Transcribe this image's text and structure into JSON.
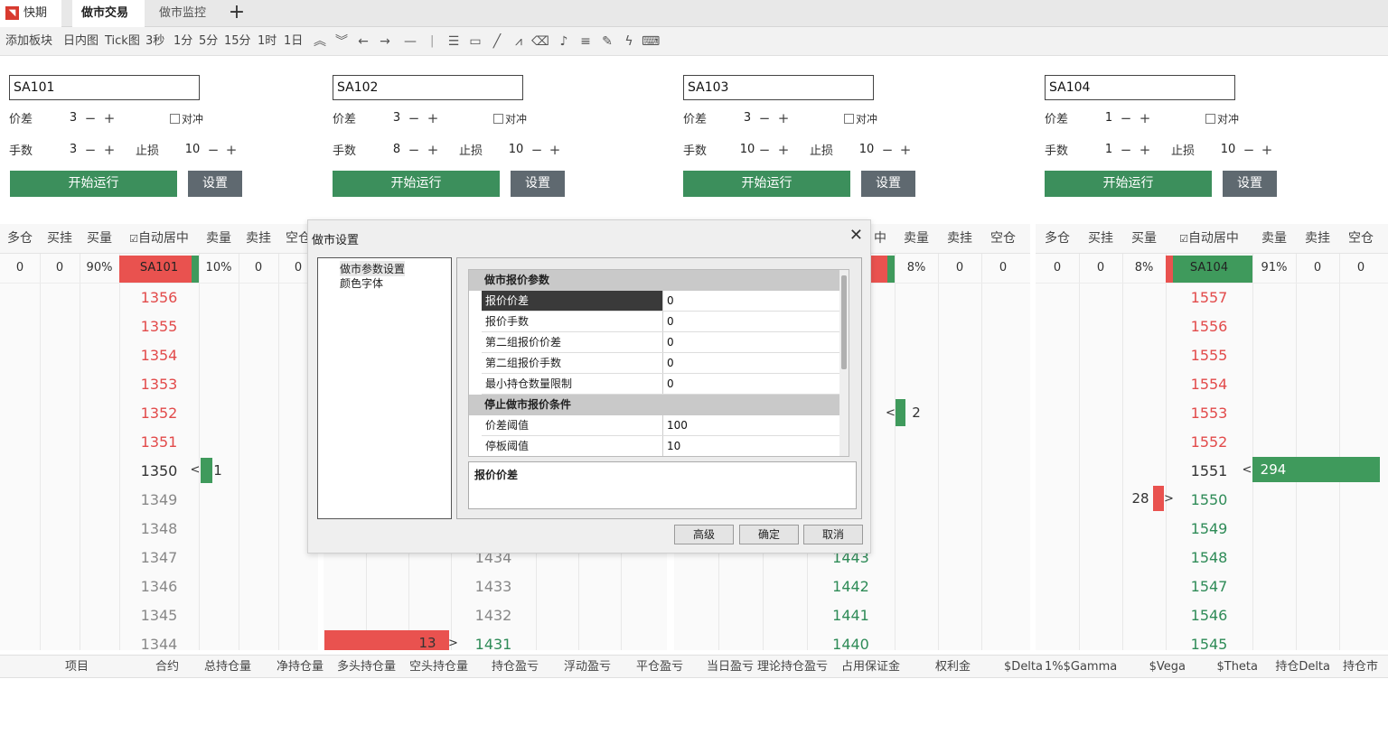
{
  "tabs": {
    "app": "快期3",
    "t1": "做市交易",
    "t2": "做市监控",
    "add": "+"
  },
  "toolbar": {
    "add_block": "添加板块",
    "periods": [
      "日内图",
      "Tick图",
      "3秒",
      "1分",
      "5分",
      "15分",
      "1时",
      "1日"
    ],
    "divider": "|",
    "tool_icons": [
      "double-up-icon",
      "double-down-icon",
      "arrow-left-icon",
      "arrow-right-icon",
      "hline-icon",
      "text-icon",
      "rect-icon",
      "line-icon",
      "zigzag-icon",
      "eraser-icon",
      "bell-icon",
      "settings-icon",
      "pen-icon",
      "lightning-icon",
      "keyboard-icon"
    ]
  },
  "labels": {
    "spread": "价差",
    "lots": "手数",
    "stoploss": "止损",
    "hedge": "对冲",
    "start": "开始运行",
    "settings": "设置",
    "minus": "−",
    "plus": "+",
    "arrow_left": "<",
    "arrow_right": ">"
  },
  "panels": [
    {
      "symbol": "SA101",
      "spread": "3",
      "lots": "3",
      "stoploss": "10"
    },
    {
      "symbol": "SA102",
      "spread": "3",
      "lots": "8",
      "stoploss": "10"
    },
    {
      "symbol": "SA103",
      "spread": "3",
      "lots": "10",
      "stoploss": "10"
    },
    {
      "symbol": "SA104",
      "spread": "1",
      "lots": "1",
      "stoploss": "10"
    }
  ],
  "ladder_headers": [
    "多仓",
    "买挂",
    "买量",
    "自动居中",
    "卖量",
    "卖挂",
    "空仓"
  ],
  "ladders": [
    {
      "summary": {
        "long": "0",
        "bid": "0",
        "bid_pct": "90%",
        "symbol": "SA101",
        "ask_pct": "10%",
        "ask": "0",
        "short": "0"
      },
      "prices": [
        "1356",
        "1355",
        "1354",
        "1353",
        "1352",
        "1351",
        "1350",
        "1349",
        "1348",
        "1347",
        "1346",
        "1345",
        "1344"
      ],
      "ask_vol": "1"
    },
    {
      "prices": [
        "1434",
        "1433",
        "1432",
        "1431"
      ],
      "bid_vol": "13"
    },
    {
      "summary": {
        "ask_pct": "8%",
        "ask": "0",
        "short": "0",
        "center_tail": "中"
      },
      "prices": [
        "1443",
        "1442",
        "1441",
        "1440"
      ],
      "ask_vol": "2"
    },
    {
      "summary": {
        "long": "0",
        "bid": "0",
        "bid_pct": "8%",
        "symbol": "SA104",
        "ask_pct": "91%",
        "ask": "0",
        "short": "0"
      },
      "prices": [
        "1557",
        "1556",
        "1555",
        "1554",
        "1553",
        "1552",
        "1551",
        "1550",
        "1549",
        "1548",
        "1547",
        "1546",
        "1545"
      ],
      "ask_vol": "294",
      "bid_vol": "28"
    }
  ],
  "footer": [
    "项目",
    "合约",
    "总持仓量",
    "净持仓量",
    "多头持仓量",
    "空头持仓量",
    "持仓盈亏",
    "浮动盈亏",
    "平仓盈亏",
    "当日盈亏",
    "理论持仓盈亏",
    "占用保证金",
    "权利金",
    "$Delta",
    "1%$Gamma",
    "$Vega",
    "$Theta",
    "持仓Delta",
    "持仓市"
  ],
  "dialog": {
    "title": "做市设置",
    "close": "✕",
    "tree": [
      "做市参数设置",
      "颜色字体"
    ],
    "cat1": "做市报价参数",
    "rows1": [
      {
        "name": "报价价差",
        "value": "0"
      },
      {
        "name": "报价手数",
        "value": "0"
      },
      {
        "name": "第二组报价价差",
        "value": "0"
      },
      {
        "name": "第二组报价手数",
        "value": "0"
      },
      {
        "name": "最小持仓数量限制",
        "value": "0"
      }
    ],
    "cat2": "停止做市报价条件",
    "rows2": [
      {
        "name": "价差阈值",
        "value": "100"
      },
      {
        "name": "停板阈值",
        "value": "10"
      }
    ],
    "description": "报价价差",
    "buttons": {
      "advanced": "高级",
      "ok": "确定",
      "cancel": "取消"
    }
  },
  "colors": {
    "red": "#e24a4a",
    "green": "#3c8f5c",
    "bid_bar": "#e9524f",
    "ask_bar": "#3f9a5c"
  }
}
